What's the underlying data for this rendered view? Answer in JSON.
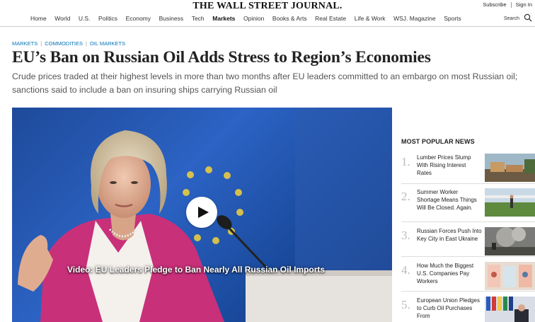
{
  "masthead": {
    "logo": "THE WALL STREET JOURNAL.",
    "subscribe": "Subscribe",
    "sign_in": "Sign In",
    "search": "Search"
  },
  "nav": [
    "Home",
    "World",
    "U.S.",
    "Politics",
    "Economy",
    "Business",
    "Tech",
    "Markets",
    "Opinion",
    "Books & Arts",
    "Real Estate",
    "Life & Work",
    "WSJ. Magazine",
    "Sports"
  ],
  "nav_active": "Markets",
  "breadcrumb": [
    "MARKETS",
    "COMMODITIES",
    "OIL MARKETS"
  ],
  "article": {
    "headline": "EU’s Ban on Russian Oil Adds Stress to Region’s Economies",
    "dek": "Crude prices traded at their highest levels in more than two months after EU leaders committed to an embargo on most Russian oil; sanctions said to include a ban on insuring ships carrying Russian oil"
  },
  "video": {
    "caption": "Video: EU Leaders Pledge to Ban Nearly All Russian Oil Imports"
  },
  "most_popular": {
    "title": "MOST POPULAR NEWS",
    "items": [
      {
        "rank": "1.",
        "text": "Lumber Prices Slump With Rising Interest Rates"
      },
      {
        "rank": "2.",
        "text": "Summer Worker Shortage Means Things Will Be Closed. Again."
      },
      {
        "rank": "3.",
        "text": "Russian Forces Push Into Key City in East Ukraine"
      },
      {
        "rank": "4.",
        "text": "How Much the Biggest U.S. Companies Pay Workers"
      },
      {
        "rank": "5.",
        "text": "European Union Pledges to Curb Oil Purchases From"
      }
    ]
  },
  "colors": {
    "link_blue": "#0274b6",
    "video_blue": "#2c63c4",
    "jacket_pink": "#c8307a"
  }
}
